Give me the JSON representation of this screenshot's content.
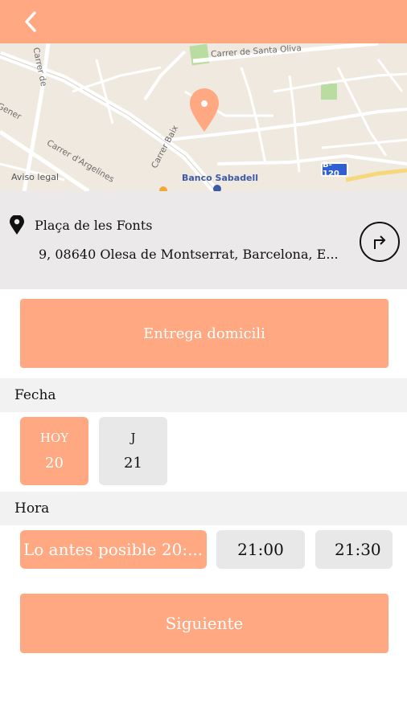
{
  "header": {
    "back_icon": "chevron-left-icon",
    "color": "#ffa882"
  },
  "map": {
    "streets": [
      "Carrer de Santa Oliva",
      "Carrer d'Argelines",
      "Carrer Baix",
      "Gener",
      "Carrer de"
    ],
    "legal_label": "Aviso legal",
    "poi_label": "Banco Sabadell",
    "road_shield": "B-120",
    "marker_icon": "map-pin-icon"
  },
  "address": {
    "name": "Plaça de les Fonts",
    "line": "9, 08640 Olesa de Montserrat, Barcelona, E...",
    "location_icon": "location-pin-icon",
    "directions_icon": "directions-arrow-icon"
  },
  "delivery_button": {
    "label": "Entrega domicili"
  },
  "fecha": {
    "title": "Fecha",
    "days": [
      {
        "top": "HOY",
        "number": "20",
        "selected": true
      },
      {
        "top": "J",
        "number": "21",
        "selected": false
      }
    ]
  },
  "hora": {
    "title": "Hora",
    "slots": [
      {
        "label": "Lo antes posible 20:...",
        "selected": true
      },
      {
        "label": "21:00",
        "selected": false
      },
      {
        "label": "21:30",
        "selected": false
      }
    ]
  },
  "next_button": {
    "label": "Siguiente"
  },
  "colors": {
    "accent": "#ffa882",
    "panel": "#ebe9ea",
    "tile": "#e8e8e8"
  }
}
